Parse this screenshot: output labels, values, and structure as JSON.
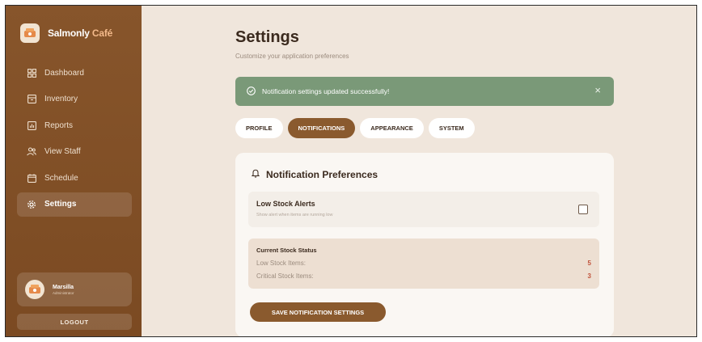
{
  "brand": {
    "name": "Salmonly",
    "accent": "Café"
  },
  "sidebar": {
    "items": [
      {
        "label": "Dashboard",
        "icon": "dashboard-icon"
      },
      {
        "label": "Inventory",
        "icon": "inventory-icon"
      },
      {
        "label": "Reports",
        "icon": "reports-icon"
      },
      {
        "label": "View Staff",
        "icon": "staff-icon"
      },
      {
        "label": "Schedule",
        "icon": "calendar-icon"
      },
      {
        "label": "Settings",
        "icon": "gear-icon",
        "active": true
      }
    ]
  },
  "user": {
    "name": "Marsilla",
    "role": "Administrator"
  },
  "logout_label": "LOGOUT",
  "page": {
    "title": "Settings",
    "subtitle": "Customize your application preferences"
  },
  "alert": {
    "message": "Notification settings updated successfully!",
    "close": "×"
  },
  "tabs": [
    {
      "label": "PROFILE"
    },
    {
      "label": "NOTIFICATIONS",
      "active": true
    },
    {
      "label": "APPEARANCE"
    },
    {
      "label": "SYSTEM"
    }
  ],
  "notifications": {
    "title": "Notification Preferences",
    "low_stock": {
      "title": "Low Stock Alerts",
      "description": "Show alert when items are running low",
      "checked": false
    },
    "stock_status": {
      "title": "Current Stock Status",
      "rows": [
        {
          "label": "Low Stock Items:",
          "value": "5"
        },
        {
          "label": "Critical Stock Items:",
          "value": "3"
        }
      ]
    },
    "save_label": "SAVE NOTIFICATION SETTINGS"
  },
  "colors": {
    "sidebar": "#7f4e26",
    "accent": "#8a5a2e",
    "success": "#7a9978",
    "background": "#f0e6dc",
    "warning_value": "#c0533b"
  }
}
